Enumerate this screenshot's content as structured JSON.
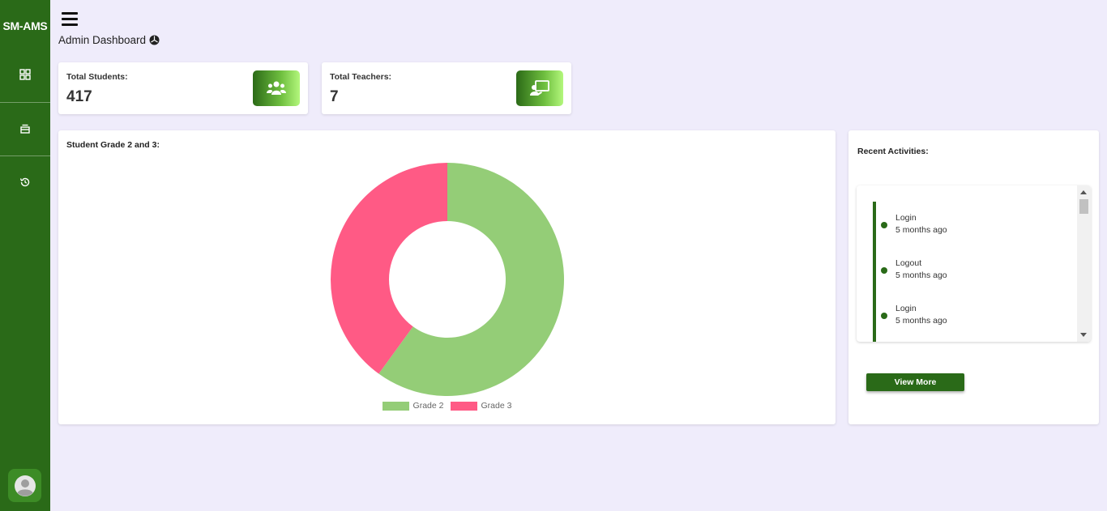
{
  "app": {
    "brand": "SM-AMS"
  },
  "sidebar": {
    "items": [
      {
        "name": "dashboard",
        "icon": "grid-icon"
      },
      {
        "name": "archive",
        "icon": "inbox-icon"
      },
      {
        "name": "history",
        "icon": "history-icon"
      }
    ]
  },
  "header": {
    "title": "Admin Dashboard",
    "info_icon": "info-icon"
  },
  "stats": {
    "students": {
      "label": "Total Students:",
      "value": "417",
      "icon": "users-icon"
    },
    "teachers": {
      "label": "Total Teachers:",
      "value": "7",
      "icon": "chalkboard-teacher-icon"
    }
  },
  "chart_data": {
    "type": "pie",
    "title": "Student Grade 2 and 3:",
    "categories": [
      "Grade 2",
      "Grade 3"
    ],
    "values": [
      60,
      40
    ],
    "colors": [
      "#94cd77",
      "#ff5a85"
    ],
    "donut": true,
    "legend": "bottom"
  },
  "activities": {
    "title": "Recent Activities:",
    "items": [
      {
        "action": "Login",
        "time": "5 months ago"
      },
      {
        "action": "Logout",
        "time": "5 months ago"
      },
      {
        "action": "Login",
        "time": "5 months ago"
      }
    ],
    "view_more_label": "View More"
  },
  "colors": {
    "primary": "#2a6a18",
    "background": "#efecfb"
  }
}
